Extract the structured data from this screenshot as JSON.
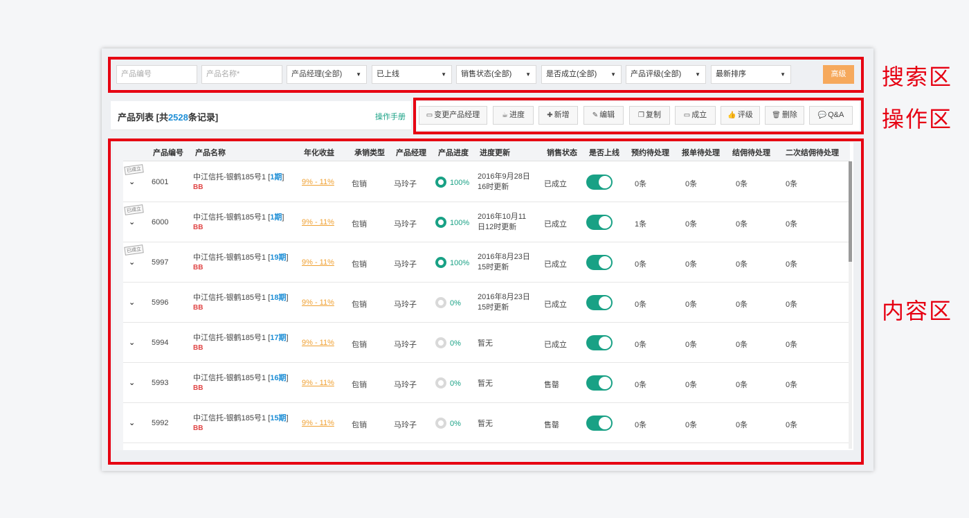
{
  "search": {
    "product_code_placeholder": "产品编号",
    "product_name_placeholder": "产品名称*",
    "selects": [
      "产品经理(全部)",
      "已上线",
      "销售状态(全部)",
      "是否成立(全部)",
      "产品评级(全部)",
      "最新排序"
    ],
    "advanced_label": "高级"
  },
  "zones": {
    "search": "搜索区",
    "action": "操作区",
    "content": "内容区"
  },
  "list": {
    "title_prefix": "产品列表 [共",
    "count": "2528",
    "title_suffix": "条记录]",
    "manual_link": "操作手册"
  },
  "toolbar": [
    {
      "label": "变更产品经理",
      "icon": "▭"
    },
    {
      "label": "进度",
      "icon": "☕"
    },
    {
      "label": "新增",
      "icon": "✚"
    },
    {
      "label": "编辑",
      "icon": "✎"
    },
    {
      "label": "复制",
      "icon": "❐"
    },
    {
      "label": "成立",
      "icon": "▭"
    },
    {
      "label": "评级",
      "icon": "👍"
    },
    {
      "label": "删除",
      "icon": "🗑"
    },
    {
      "label": "Q&A",
      "icon": "💬"
    }
  ],
  "columns": [
    "产品编号",
    "产品名称",
    "年化收益",
    "承销类型",
    "产品经理",
    "产品进度",
    "进度更新",
    "销售状态",
    "是否上线",
    "预约待处理",
    "报单待处理",
    "结佣待处理",
    "二次结佣待处理"
  ],
  "rows": [
    {
      "stamp": "已成立",
      "code": "6001",
      "name": "中江信托-银鹤185号1",
      "period": "1期",
      "tag": "BB",
      "yield": "9% - 11%",
      "type": "包销",
      "manager": "马玲子",
      "progress": "100%",
      "update1": "2016年9月28日",
      "update2": "16时更新",
      "status": "已成立",
      "c1": "0条",
      "c2": "0条",
      "c3": "0条",
      "c4": "0条"
    },
    {
      "stamp": "已成立",
      "code": "6000",
      "name": "中江信托-银鹤185号1",
      "period": "1期",
      "tag": "BB",
      "yield": "9% - 11%",
      "type": "包销",
      "manager": "马玲子",
      "progress": "100%",
      "update1": "2016年10月11",
      "update2": "日12时更新",
      "status": "已成立",
      "c1": "1条",
      "c2": "0条",
      "c3": "0条",
      "c4": "0条"
    },
    {
      "stamp": "已成立",
      "code": "5997",
      "name": "中江信托-银鹤185号1",
      "period": "19期",
      "tag": "BB",
      "yield": "9% - 11%",
      "type": "包销",
      "manager": "马玲子",
      "progress": "100%",
      "update1": "2016年8月23日",
      "update2": "15时更新",
      "status": "已成立",
      "c1": "0条",
      "c2": "0条",
      "c3": "0条",
      "c4": "0条"
    },
    {
      "stamp": "",
      "code": "5996",
      "name": "中江信托-银鹤185号1",
      "period": "18期",
      "tag": "BB",
      "yield": "9% - 11%",
      "type": "包销",
      "manager": "马玲子",
      "progress": "0%",
      "update1": "2016年8月23日",
      "update2": "15时更新",
      "status": "已成立",
      "c1": "0条",
      "c2": "0条",
      "c3": "0条",
      "c4": "0条"
    },
    {
      "stamp": "",
      "code": "5994",
      "name": "中江信托-银鹤185号1",
      "period": "17期",
      "tag": "BB",
      "yield": "9% - 11%",
      "type": "包销",
      "manager": "马玲子",
      "progress": "0%",
      "update1": "暂无",
      "update2": "",
      "status": "已成立",
      "c1": "0条",
      "c2": "0条",
      "c3": "0条",
      "c4": "0条"
    },
    {
      "stamp": "",
      "code": "5993",
      "name": "中江信托-银鹤185号1",
      "period": "16期",
      "tag": "BB",
      "yield": "9% - 11%",
      "type": "包销",
      "manager": "马玲子",
      "progress": "0%",
      "update1": "暂无",
      "update2": "",
      "status": "售罄",
      "c1": "0条",
      "c2": "0条",
      "c3": "0条",
      "c4": "0条"
    },
    {
      "stamp": "",
      "code": "5992",
      "name": "中江信托-银鹤185号1",
      "period": "15期",
      "tag": "BB",
      "yield": "9% - 11%",
      "type": "包销",
      "manager": "马玲子",
      "progress": "0%",
      "update1": "暂无",
      "update2": "",
      "status": "售罄",
      "c1": "0条",
      "c2": "0条",
      "c3": "0条",
      "c4": "0条"
    }
  ],
  "colors": {
    "accent": "#19a185",
    "red_frame": "#e60012",
    "advanced_button": "#f6a95c",
    "link_blue": "#1f8fd6"
  }
}
